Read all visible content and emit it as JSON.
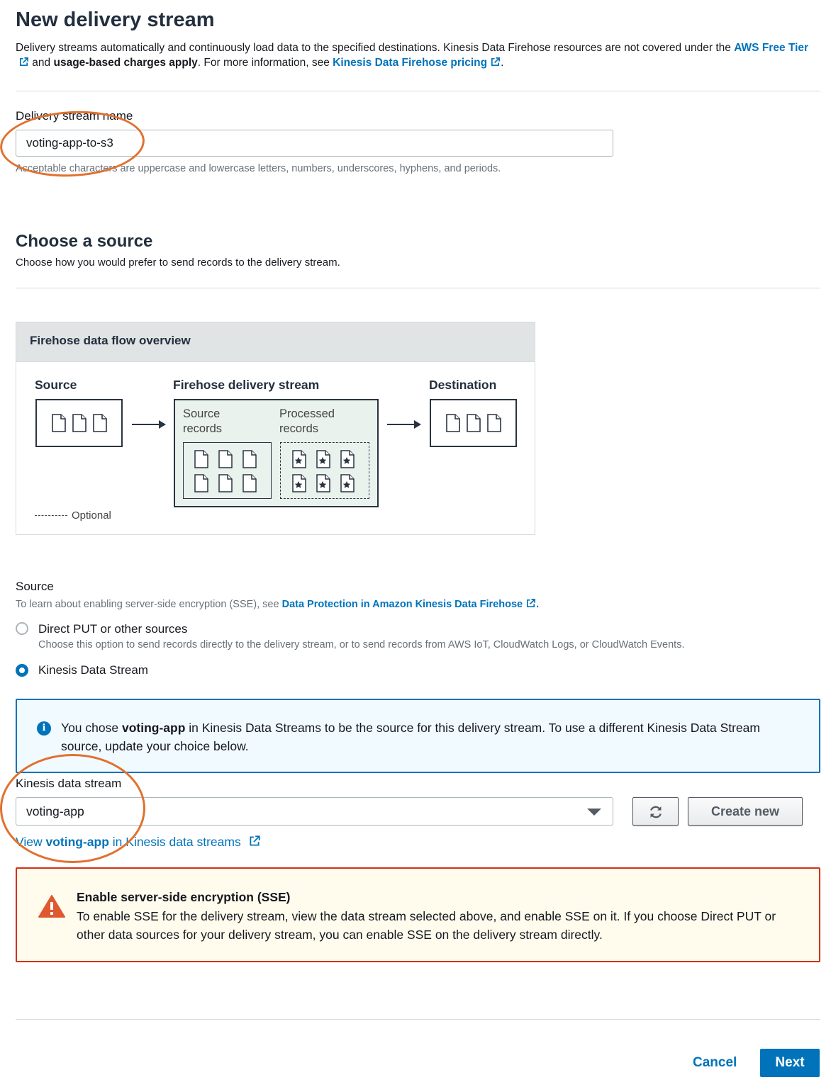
{
  "page": {
    "title": "New delivery stream",
    "intro": {
      "text1": "Delivery streams automatically and continuously load data to the specified destinations. Kinesis Data Firehose resources are not covered under the ",
      "link_free_tier": "AWS Free Tier",
      "text2": " and ",
      "bold_charges": "usage-based charges apply",
      "text3": ". For more information, see ",
      "link_pricing": "Kinesis Data Firehose pricing",
      "text4": "."
    }
  },
  "name_field": {
    "label": "Delivery stream name",
    "value": "voting-app-to-s3",
    "hint": "Acceptable characters are uppercase and lowercase letters, numbers, underscores, hyphens, and periods."
  },
  "source_section": {
    "title": "Choose a source",
    "description": "Choose how you would prefer to send records to the delivery stream."
  },
  "flow_overview": {
    "header": "Firehose data flow overview",
    "source_label": "Source",
    "stream_label": "Firehose delivery stream",
    "destination_label": "Destination",
    "source_records_line1": "Source",
    "source_records_line2": "records",
    "processed_records_line1": "Processed",
    "processed_records_line2": "records",
    "optional_legend": "Optional"
  },
  "source_choice": {
    "label": "Source",
    "hint_text": "To learn about enabling server-side encryption (SSE), see ",
    "hint_link": "Data Protection in Amazon Kinesis Data Firehose",
    "hint_end": ".",
    "options": [
      {
        "label": "Direct PUT or other sources",
        "description": "Choose this option to send records directly to the delivery stream, or to send records from AWS IoT, CloudWatch Logs, or CloudWatch Events.",
        "selected": false
      },
      {
        "label": "Kinesis Data Stream",
        "selected": true
      }
    ]
  },
  "info_alert": {
    "text1": "You chose ",
    "bold": "voting-app",
    "text2": " in Kinesis Data Streams to be the source for this delivery stream. To use a different Kinesis Data Stream source, update your choice below."
  },
  "stream_select": {
    "label": "Kinesis data stream",
    "value": "voting-app",
    "create_new_label": "Create new",
    "view_prefix": "View ",
    "view_bold": "voting-app",
    "view_suffix": " in Kinesis data streams"
  },
  "warning_alert": {
    "title": "Enable server-side encryption (SSE)",
    "text": "To enable SSE for the delivery stream, view the data stream selected above, and enable SSE on it. If you choose Direct PUT or other data sources for your delivery stream, you can enable SSE on the delivery stream directly."
  },
  "footer": {
    "cancel_label": "Cancel",
    "next_label": "Next"
  },
  "colors": {
    "link": "#0073bb",
    "primary": "#0073bb",
    "warning_border": "#d13212",
    "warning_icon": "#e0582f",
    "annotation_circle": "#e0712f"
  },
  "icons": [
    "external-link-icon",
    "document-icon",
    "starred-document-icon",
    "arrow-right-icon",
    "info-icon",
    "refresh-icon",
    "caret-down-icon",
    "warning-icon"
  ]
}
